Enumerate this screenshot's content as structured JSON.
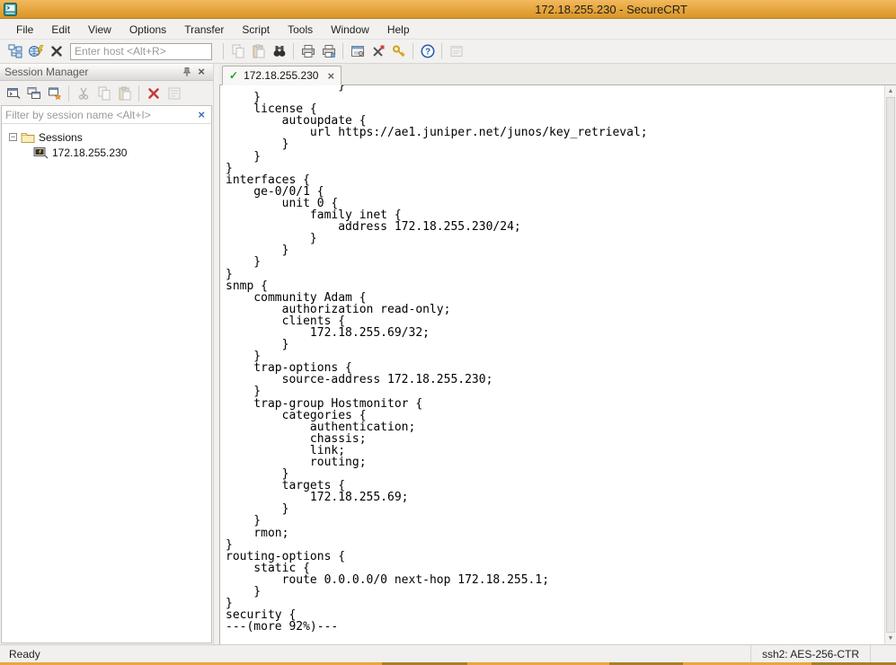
{
  "window": {
    "title": "172.18.255.230 - SecureCRT"
  },
  "menu": {
    "items": [
      "File",
      "Edit",
      "View",
      "Options",
      "Transfer",
      "Script",
      "Tools",
      "Window",
      "Help"
    ]
  },
  "toolbar": {
    "host_placeholder": "Enter host <Alt+R>"
  },
  "session_manager": {
    "title": "Session Manager",
    "filter_placeholder": "Filter by session name <Alt+I>",
    "tree": {
      "root": "Sessions",
      "sessions": [
        "172.18.255.230"
      ]
    }
  },
  "tabs": [
    {
      "label": "172.18.255.230",
      "status": "connected"
    }
  ],
  "terminal": {
    "lines": [
      "                }",
      "    }",
      "    license {",
      "        autoupdate {",
      "            url https://ae1.juniper.net/junos/key_retrieval;",
      "        }",
      "    }",
      "}",
      "interfaces {",
      "    ge-0/0/1 {",
      "        unit 0 {",
      "            family inet {",
      "                address 172.18.255.230/24;",
      "            }",
      "        }",
      "    }",
      "}",
      "snmp {",
      "    community Adam {",
      "        authorization read-only;",
      "        clients {",
      "            172.18.255.69/32;",
      "        }",
      "    }",
      "    trap-options {",
      "        source-address 172.18.255.230;",
      "    }",
      "    trap-group Hostmonitor {",
      "        categories {",
      "            authentication;",
      "            chassis;",
      "            link;",
      "            routing;",
      "        }",
      "        targets {",
      "            172.18.255.69;",
      "        }",
      "    }",
      "    rmon;",
      "}",
      "routing-options {",
      "    static {",
      "        route 0.0.0.0/0 next-hop 172.18.255.1;",
      "    }",
      "}",
      "security {",
      "---(more 92%)---"
    ]
  },
  "status_bar": {
    "left": "Ready",
    "right": "ssh2: AES-256-CTR"
  },
  "icons": {
    "check_glyph": "✓",
    "close_glyph": "×",
    "minus_glyph": "−",
    "help_glyph": "?",
    "up_arrow_glyph": "▲",
    "down_arrow_glyph": "▼"
  },
  "colors": {
    "titlebar_orange": "#e5a53c",
    "connected_green": "#21a321",
    "delete_red": "#c43c3c",
    "filter_clear_blue": "#3b6fb5"
  }
}
